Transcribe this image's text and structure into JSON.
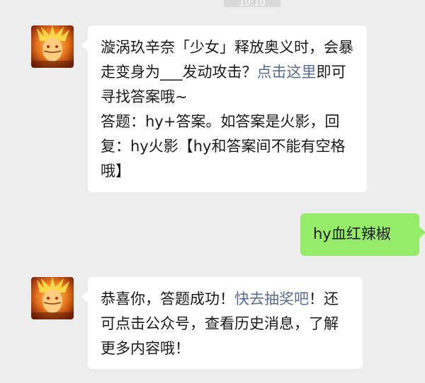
{
  "header": {
    "time": "10:10"
  },
  "messages": [
    {
      "from": "other",
      "avatar_icon": "naruto-avatar",
      "text_before_link": "漩涡玖辛奈「少女」释放奥义时，会暴走变身为___发动攻击？",
      "link_text": "点击这里",
      "text_after_link": "即可寻找答案哦~",
      "line2": "答题：hy+答案。如答案是火影，回复：hy火影【hy和答案间不能有空格哦】"
    },
    {
      "from": "self",
      "text": "hy血红辣椒"
    },
    {
      "from": "other",
      "avatar_icon": "naruto-avatar",
      "text_before_link": "恭喜你，答题成功！",
      "link_text": "快去抽奖吧",
      "text_after_link": "！还可点击公众号，查看历史消息，了解更多内容哦！"
    }
  ],
  "colors": {
    "background": "#ededed",
    "bubble_incoming": "#ffffff",
    "bubble_outgoing": "#95ec69",
    "link": "#576b95"
  }
}
